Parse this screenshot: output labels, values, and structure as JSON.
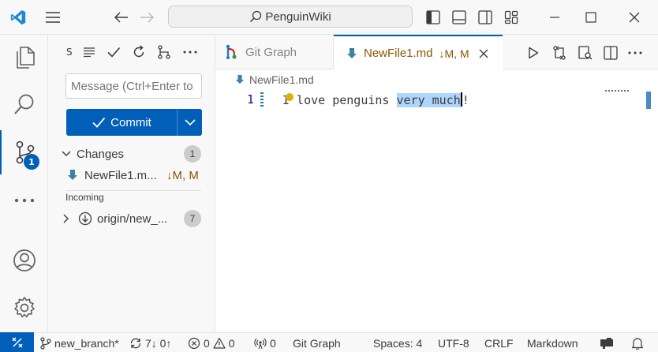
{
  "title_bar": {
    "app_icon": "vscode-logo-icon",
    "menu_icon": "hamburger-menu-icon",
    "back_icon": "arrow-left-icon",
    "forward_icon": "arrow-right-icon",
    "search_text": "PenguinWiki",
    "layout_icons": [
      "toggle-primary-sidebar-icon",
      "toggle-panel-icon",
      "toggle-secondary-sidebar-icon",
      "customize-layout-icon"
    ],
    "window_controls": [
      "minimize-icon",
      "maximize-icon",
      "close-icon"
    ]
  },
  "activity_bar": {
    "items": [
      "explorer-icon",
      "search-icon",
      "source-control-icon",
      "more-icon"
    ],
    "source_control_badge": "1",
    "bottom": [
      "accounts-icon",
      "manage-gear-icon"
    ]
  },
  "sidebar": {
    "title": "S",
    "toolbar_icons": [
      "view-as-list-icon",
      "commit-check-icon",
      "refresh-icon",
      "branch-graph-icon",
      "more-actions-icon"
    ],
    "message_placeholder": "Message (Ctrl+Enter to commit on 'new_branch')",
    "commit_label": "Commit",
    "changes_label": "Changes",
    "changes_count": "1",
    "change_file": "NewFile1.m...",
    "change_status": "↓M, M",
    "incoming_label": "Incoming",
    "incoming_item": "origin/new_...",
    "incoming_count": "7"
  },
  "tabs": {
    "inactive_label": "Git Graph",
    "active_label": "NewFile1.md",
    "active_status": "↓M, M"
  },
  "editor": {
    "breadcrumb": "NewFile1.md",
    "line_number": "1",
    "code_before": "I love penguins ",
    "code_selected": "very much",
    "code_after": "!"
  },
  "status_bar": {
    "branch": "new_branch*",
    "sync": "7↓ 0↑",
    "errors": "0",
    "warnings": "0",
    "ports": "0",
    "git_graph": "Git Graph",
    "spaces": "Spaces: 4",
    "encoding": "UTF-8",
    "eol": "CRLF",
    "language": "Markdown"
  },
  "colors": {
    "accent": "#005fb8",
    "modified": "#895503",
    "selection": "#add6ff"
  }
}
